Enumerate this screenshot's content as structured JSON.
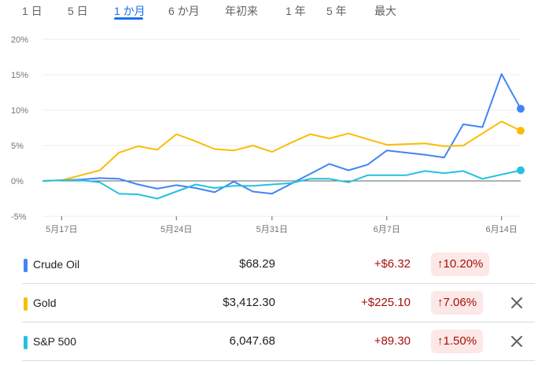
{
  "tabs": [
    {
      "label": "1 日"
    },
    {
      "label": "5 日"
    },
    {
      "label": "1 か月",
      "active": true
    },
    {
      "label": "6 か月"
    },
    {
      "label": "年初来"
    },
    {
      "label": "1 年"
    },
    {
      "label": "5 年"
    },
    {
      "label": "最大"
    }
  ],
  "chart_data": {
    "type": "line",
    "y_ticks": [
      "20%",
      "15%",
      "10%",
      "5%",
      "0%",
      "-5%"
    ],
    "ylim": [
      -5,
      20
    ],
    "unit": "%",
    "x_tick_labels": [
      "5月17日",
      "5月24日",
      "5月31日",
      "6月7日",
      "6月14日"
    ],
    "grid": true,
    "series": [
      {
        "name": "Crude Oil",
        "color": "#4285f4",
        "values": [
          0,
          0.1,
          0.2,
          0.4,
          0.3,
          -0.5,
          -1.1,
          -0.6,
          -1.0,
          -1.6,
          -0.1,
          -1.5,
          -1.8,
          -0.4,
          1.0,
          2.4,
          1.5,
          2.3,
          4.3,
          4.0,
          3.7,
          3.3,
          8.0,
          7.6,
          15.1,
          10.2
        ]
      },
      {
        "name": "Gold",
        "color": "#fbbc04",
        "values": [
          0,
          0.1,
          0.8,
          1.5,
          4.0,
          4.9,
          4.4,
          6.6,
          5.6,
          4.5,
          4.3,
          5.0,
          4.1,
          5.4,
          6.6,
          6.0,
          6.7,
          5.9,
          5.1,
          5.2,
          5.3,
          4.9,
          5.0,
          6.7,
          8.4,
          7.1
        ]
      },
      {
        "name": "S&P 500",
        "color": "#24c1e0",
        "values": [
          0,
          0.1,
          0.1,
          -0.2,
          -1.8,
          -1.9,
          -2.5,
          -1.5,
          -0.5,
          -1.0,
          -0.7,
          -0.7,
          -0.5,
          -0.3,
          0.3,
          0.3,
          -0.2,
          0.8,
          0.8,
          0.8,
          1.4,
          1.1,
          1.4,
          0.3,
          0.9,
          1.5
        ]
      }
    ]
  },
  "rows": [
    {
      "name": "Crude Oil",
      "price": "$68.29",
      "change": "+$6.32",
      "pct": "↑10.20%",
      "color": "#4285f4"
    },
    {
      "name": "Gold",
      "price": "$3,412.30",
      "change": "+$225.10",
      "pct": "↑7.06%",
      "color": "#fbbc04",
      "removable": true
    },
    {
      "name": "S&P 500",
      "price": "6,047.68",
      "change": "+89.30",
      "pct": "↑1.50%",
      "color": "#24c1e0",
      "removable": true
    }
  ],
  "icons": {
    "remove": "close-icon"
  }
}
